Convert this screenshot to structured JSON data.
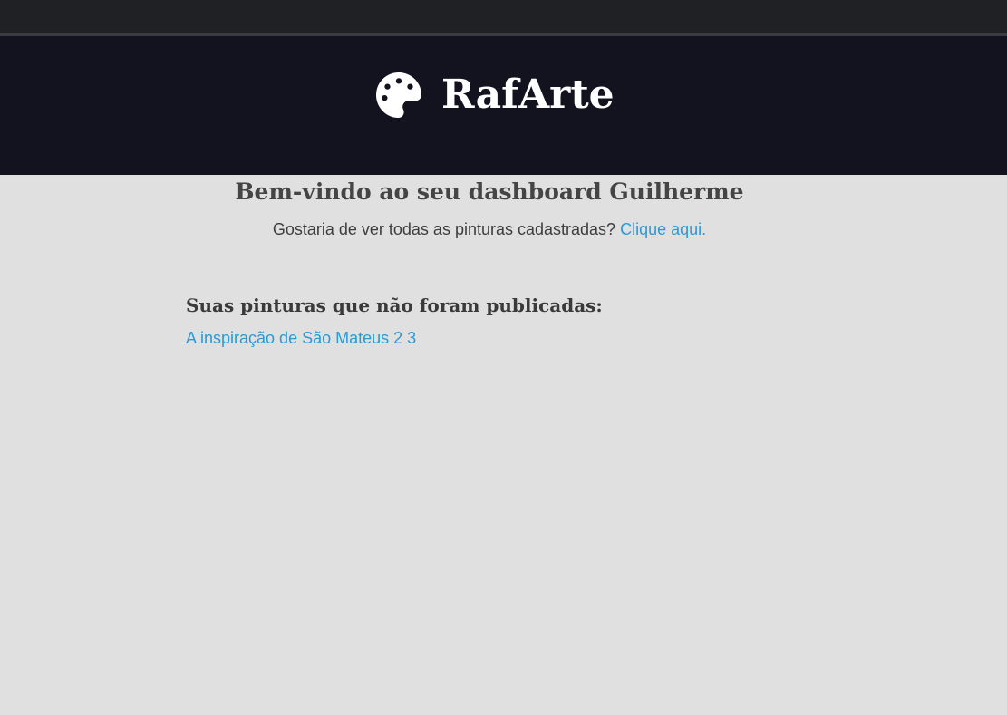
{
  "header": {
    "brand_name": "RafArte",
    "logo_icon": "palette-icon",
    "colors": {
      "background": "#13131f",
      "text": "#ffffff"
    }
  },
  "dashboard": {
    "welcome_title": "Bem-vindo ao seu dashboard Guilherme",
    "question_text": "Gostaria de ver todas as pinturas cadastradas?",
    "question_link_label": "Clique aqui.",
    "unpublished_title": "Suas pinturas que não foram publicadas:",
    "unpublished_paintings": [
      {
        "title": "A inspiração de São Mateus 2 3"
      }
    ]
  },
  "colors": {
    "page_background": "#e0e0e0",
    "link": "#2a9ad6",
    "text": "#454545"
  }
}
